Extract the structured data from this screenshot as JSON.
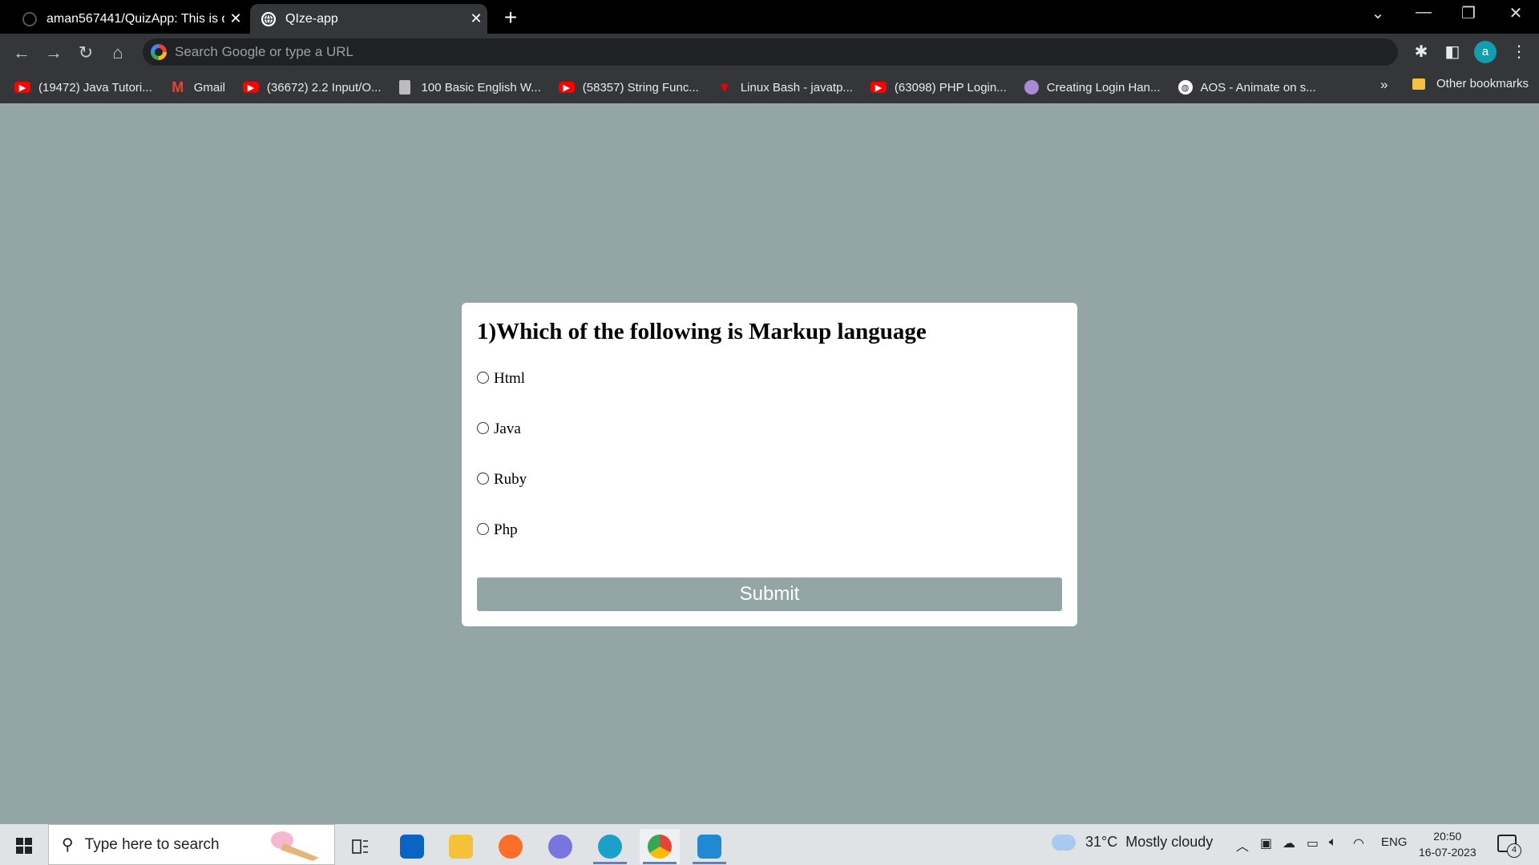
{
  "browser": {
    "tabs": [
      {
        "title": "aman567441/QuizApp: This is qu",
        "active": false
      },
      {
        "title": "QIze-app",
        "active": true
      }
    ],
    "omnibox_placeholder": "Search Google or type a URL",
    "profile_initial": "a",
    "bookmarks": [
      {
        "label": "(19472) Java Tutori...",
        "icon": "youtube-icon"
      },
      {
        "label": "Gmail",
        "icon": "gmail-icon"
      },
      {
        "label": "(36672) 2.2 Input/O...",
        "icon": "youtube-icon"
      },
      {
        "label": "100 Basic English W...",
        "icon": "document-icon"
      },
      {
        "label": "(58357) String Func...",
        "icon": "youtube-icon"
      },
      {
        "label": "Linux Bash - javatp...",
        "icon": "javatpoint-icon"
      },
      {
        "label": "(63098) PHP Login...",
        "icon": "youtube-icon"
      },
      {
        "label": "Creating Login Han...",
        "icon": "avatar-icon"
      },
      {
        "label": "AOS - Animate on s...",
        "icon": "globe-icon"
      }
    ],
    "bookmarks_more": "»",
    "other_bookmarks": "Other bookmarks"
  },
  "quiz": {
    "question": "1)Which of the following is Markup language",
    "options": [
      "Html",
      "Java",
      "Ruby",
      "Php"
    ],
    "submit_label": "Submit"
  },
  "colors": {
    "page_bg": "#93a5a5",
    "card_bg": "#ffffff",
    "submit_bg": "#93a5a5"
  },
  "taskbar": {
    "search_placeholder": "Type here to search",
    "weather": "31°C  Mostly cloudy",
    "language": "ENG",
    "time": "20:50",
    "date": "16-07-2023",
    "notifications": "4"
  }
}
